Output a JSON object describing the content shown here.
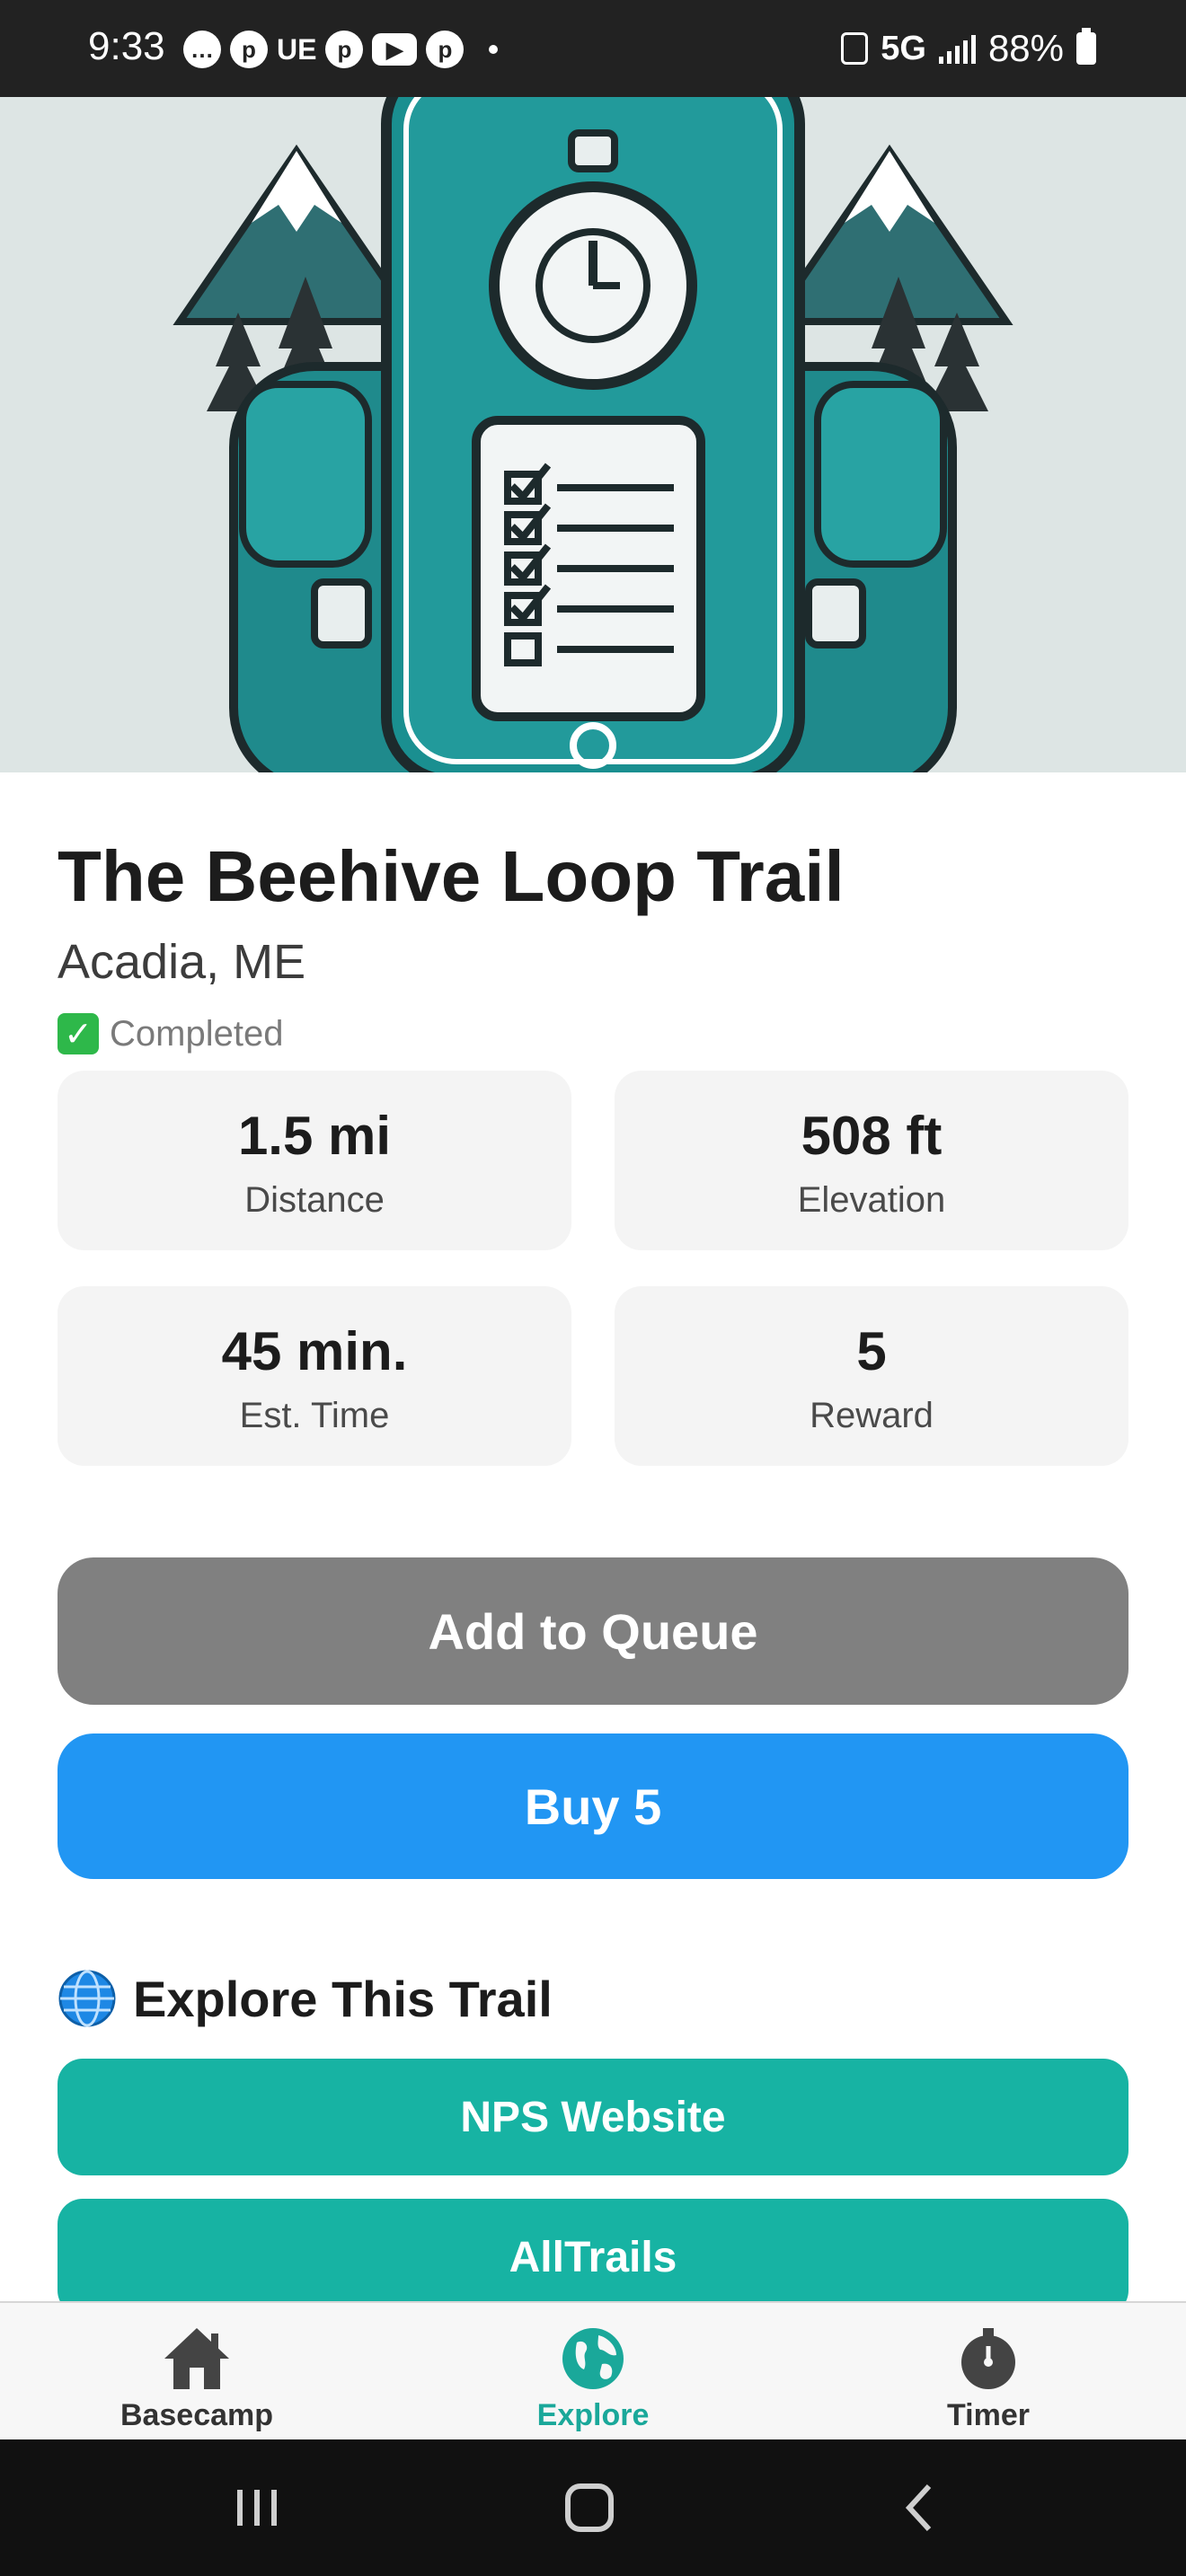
{
  "status_bar": {
    "time": "9:33",
    "notification_icons": [
      "chat-bubble-icon",
      "pinterest-icon",
      "uber-eats-text",
      "pinterest-icon",
      "youtube-icon",
      "pinterest-icon"
    ],
    "ue_text": "UE",
    "network": "5G",
    "battery": "88%"
  },
  "hero": {
    "image": "backpack-phone-stopwatch-checklist-illustration"
  },
  "trail": {
    "name": "The Beehive Loop Trail",
    "location": "Acadia, ME",
    "status": "Completed",
    "status_icon": "check-box-icon"
  },
  "stats": [
    {
      "value": "1.5 mi",
      "label": "Distance"
    },
    {
      "value": "508 ft",
      "label": "Elevation"
    },
    {
      "value": "45 min.",
      "label": "Est. Time"
    },
    {
      "value": "5",
      "label": "Reward"
    }
  ],
  "actions": {
    "queue_label": "Add to Queue",
    "buy_label": "Buy 5"
  },
  "explore": {
    "title": "Explore This Trail",
    "icon": "globe-icon",
    "links": [
      "NPS Website",
      "AllTrails"
    ]
  },
  "bottom_nav": {
    "items": [
      {
        "label": "Basecamp",
        "icon": "house-icon"
      },
      {
        "label": "Explore",
        "icon": "globe-icon"
      },
      {
        "label": "Timer",
        "icon": "stopwatch-icon"
      }
    ],
    "active": "Explore"
  },
  "colors": {
    "primary_blue": "#2196f3",
    "teal": "#17b3a3",
    "gray_button": "#808080",
    "active_nav": "#1aa89a"
  }
}
